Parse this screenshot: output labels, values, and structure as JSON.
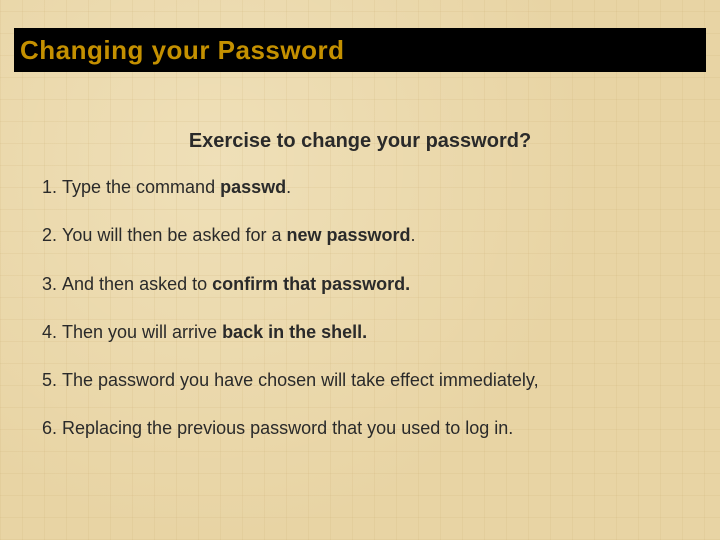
{
  "title": "Changing your Password",
  "subtitle": "Exercise to change your password?",
  "steps": [
    {
      "pre": "Type the command ",
      "bold": "passwd",
      "post": "."
    },
    {
      "pre": "You will then be asked for a ",
      "bold": "new password",
      "post": "."
    },
    {
      "pre": "And then asked to ",
      "bold": "confirm that password.",
      "post": ""
    },
    {
      "pre": "Then you will arrive ",
      "bold": "back in the shell.",
      "post": ""
    },
    {
      "pre": "The password you have chosen will take effect immediately,",
      "bold": "",
      "post": ""
    },
    {
      "pre": "Replacing the previous password that you used to log in.",
      "bold": "",
      "post": ""
    }
  ]
}
